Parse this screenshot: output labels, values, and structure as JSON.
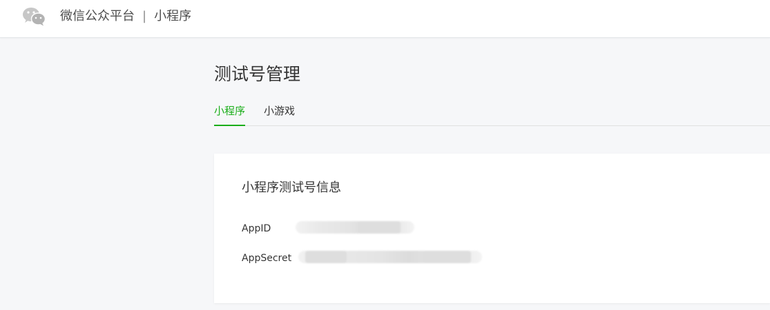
{
  "header": {
    "platform_name": "微信公众平台",
    "separator": "|",
    "product_name": "小程序",
    "logo_icon": "wechat-logo-icon"
  },
  "page": {
    "title": "测试号管理"
  },
  "tabs": [
    {
      "label": "小程序",
      "active": true
    },
    {
      "label": "小游戏",
      "active": false
    }
  ],
  "card": {
    "title": "小程序测试号信息",
    "fields": [
      {
        "label": "AppID",
        "value_visible": false
      },
      {
        "label": "AppSecret",
        "value_visible": false
      }
    ]
  },
  "colors": {
    "accent": "#1aad19",
    "page_background": "#f6f7f9",
    "header_background": "#ffffff",
    "text_primary": "#353535"
  }
}
